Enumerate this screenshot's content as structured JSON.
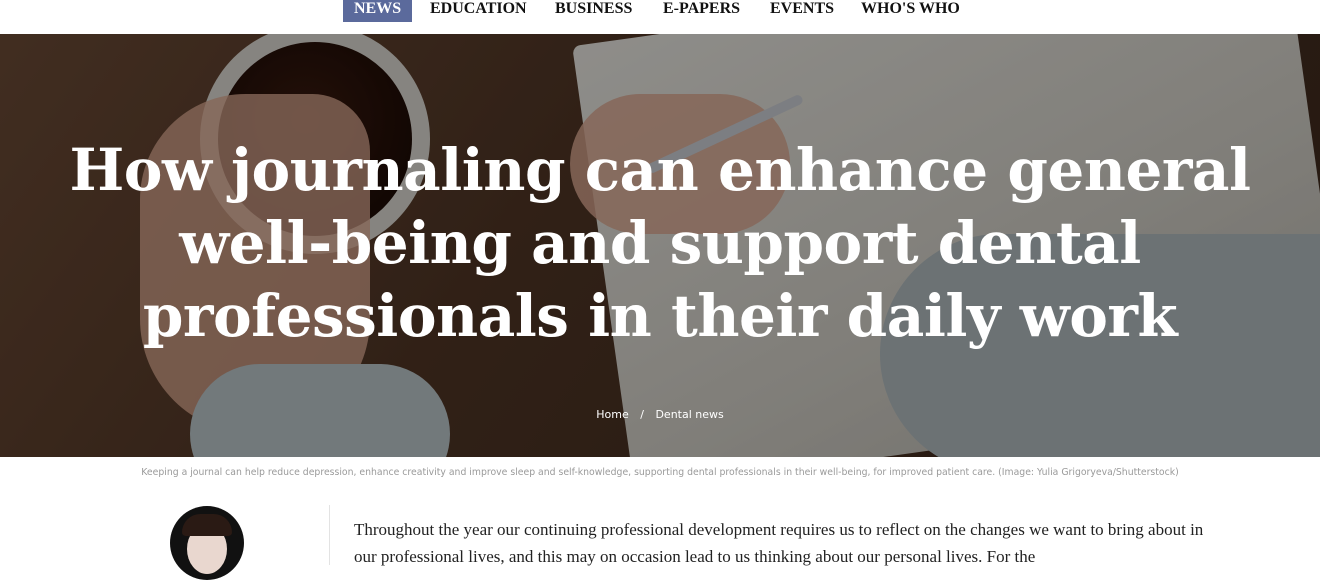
{
  "nav": {
    "items": [
      {
        "label": "NEWS",
        "active": true
      },
      {
        "label": "EDUCATION",
        "active": false
      },
      {
        "label": "BUSINESS",
        "active": false
      },
      {
        "label": "E-PAPERS",
        "active": false
      },
      {
        "label": "EVENTS",
        "active": false
      },
      {
        "label": "WHO'S WHO",
        "active": false
      }
    ],
    "active_color": "#5b6a9c"
  },
  "hero": {
    "title": "How journaling can enhance general well-being and support dental professionals in their daily work"
  },
  "breadcrumb": {
    "home": "Home",
    "separator": "/",
    "current": "Dental news"
  },
  "caption": "Keeping a journal can help reduce depression, enhance creativity and improve sleep and self-knowledge, supporting dental professionals in their well-being, for improved patient care. (Image: Yulia Grigoryeva/Shutterstock)",
  "article": {
    "intro": "Throughout the year our continuing professional development requires us to reflect on the changes we want to bring about in our professional lives, and this may on occasion lead to us thinking about our personal lives. For the"
  }
}
